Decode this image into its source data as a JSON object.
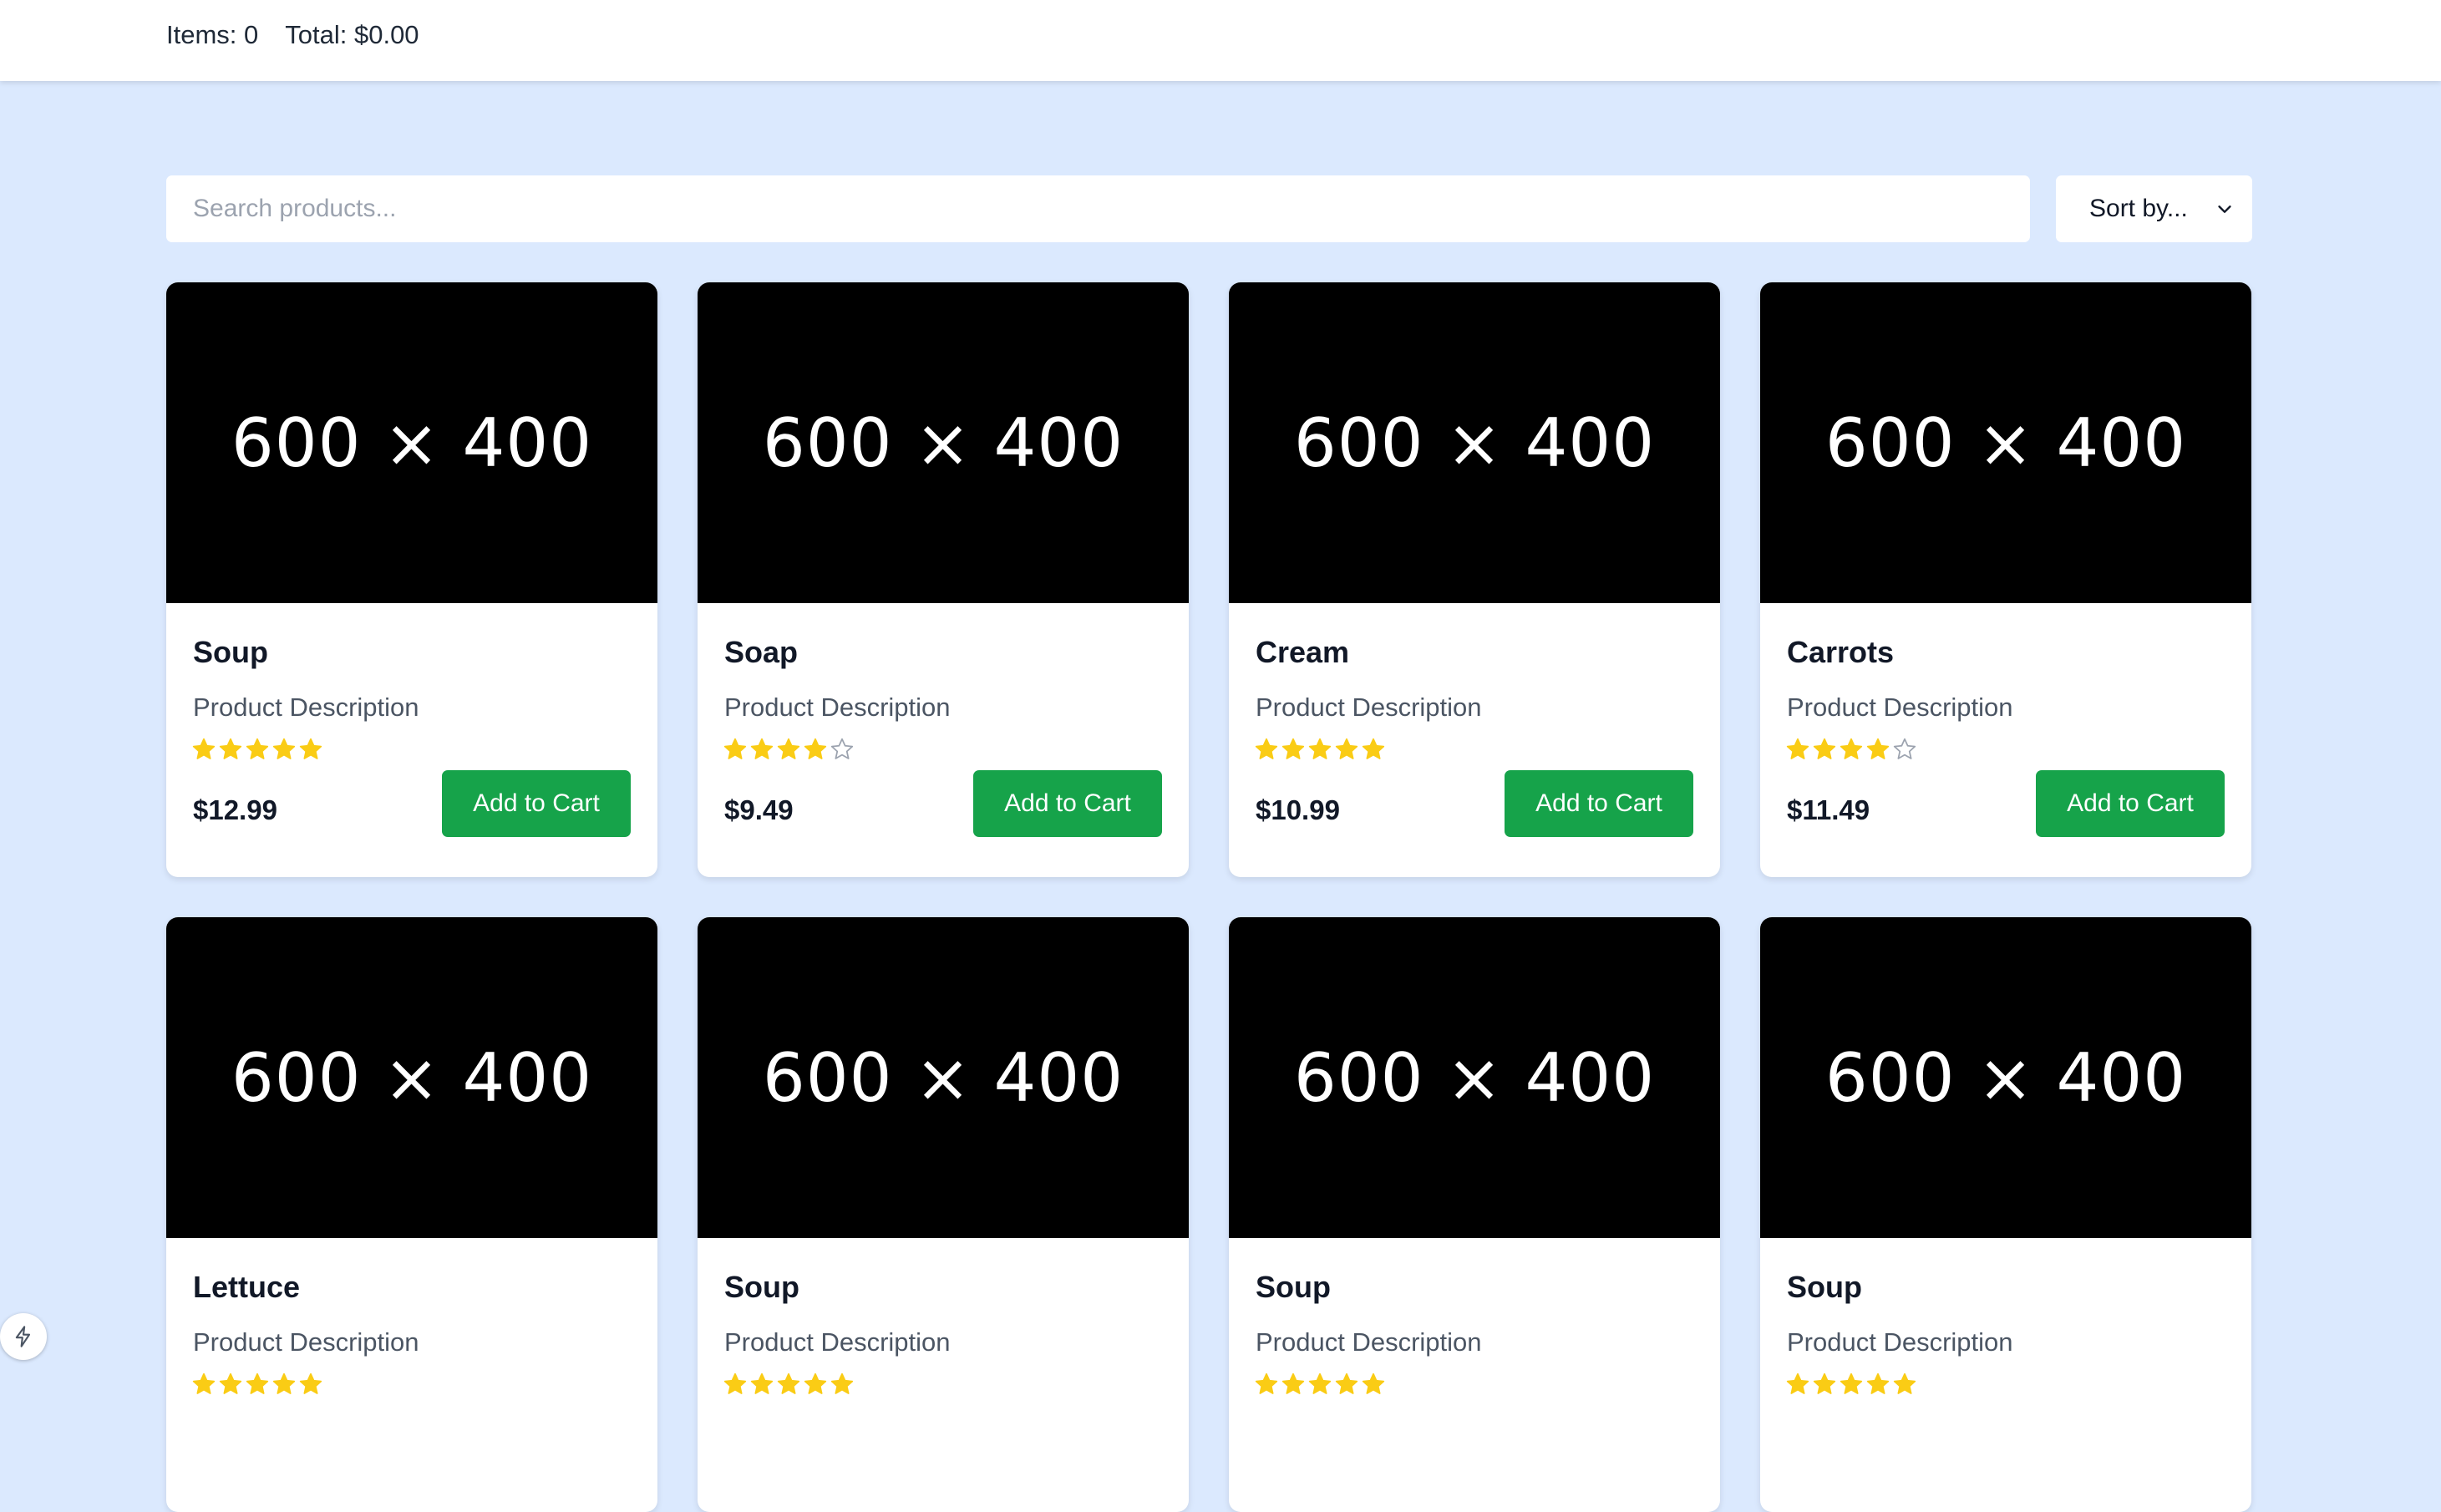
{
  "header": {
    "items_text": "Items: 0",
    "total_text": "Total: $0.00"
  },
  "search": {
    "placeholder": "Search products...",
    "value": ""
  },
  "sort": {
    "selected": "Sort by..."
  },
  "colors": {
    "page_bg": "#dbe9fe",
    "button_green": "#16a34a",
    "star_gold": "#facc15",
    "image_bg": "#000000"
  },
  "products": [
    {
      "image_text": "600 × 400",
      "name": "Soup",
      "description": "Product Description",
      "rating": 5,
      "price": "$12.99",
      "button": "Add to Cart"
    },
    {
      "image_text": "600 × 400",
      "name": "Soap",
      "description": "Product Description",
      "rating": 4,
      "price": "$9.49",
      "button": "Add to Cart"
    },
    {
      "image_text": "600 × 400",
      "name": "Cream",
      "description": "Product Description",
      "rating": 5,
      "price": "$10.99",
      "button": "Add to Cart"
    },
    {
      "image_text": "600 × 400",
      "name": "Carrots",
      "description": "Product Description",
      "rating": 4,
      "price": "$11.49",
      "button": "Add to Cart"
    },
    {
      "image_text": "600 × 400",
      "name": "Lettuce",
      "description": "Product Description",
      "rating": 5,
      "price": "",
      "button": ""
    },
    {
      "image_text": "600 × 400",
      "name": "Soup",
      "description": "Product Description",
      "rating": 5,
      "price": "",
      "button": ""
    },
    {
      "image_text": "600 × 400",
      "name": "Soup",
      "description": "Product Description",
      "rating": 5,
      "price": "",
      "button": ""
    },
    {
      "image_text": "600 × 400",
      "name": "Soup",
      "description": "Product Description",
      "rating": 5,
      "price": "",
      "button": ""
    }
  ],
  "widget": {
    "icon": "lightning-icon"
  }
}
